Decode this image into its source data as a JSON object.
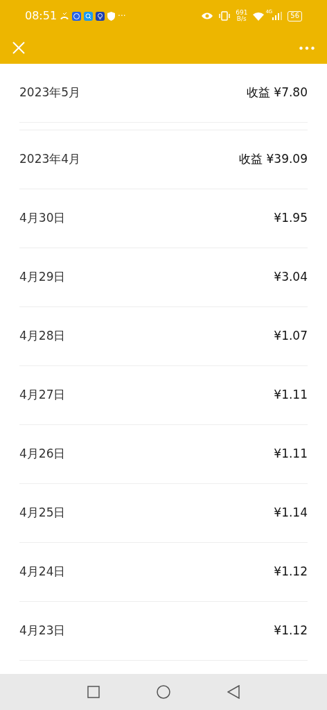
{
  "status_bar": {
    "time": "08:51",
    "more": "···",
    "speed_value": "691",
    "speed_unit": "B/s",
    "network": "4G",
    "battery": "56"
  },
  "sections": [
    {
      "month": "2023年5月",
      "income": "收益 ¥7.80"
    },
    {
      "month": "2023年4月",
      "income": "收益 ¥39.09",
      "days": [
        {
          "date": "4月30日",
          "amount": "¥1.95"
        },
        {
          "date": "4月29日",
          "amount": "¥3.04"
        },
        {
          "date": "4月28日",
          "amount": "¥1.07"
        },
        {
          "date": "4月27日",
          "amount": "¥1.11"
        },
        {
          "date": "4月26日",
          "amount": "¥1.11"
        },
        {
          "date": "4月25日",
          "amount": "¥1.14"
        },
        {
          "date": "4月24日",
          "amount": "¥1.12"
        },
        {
          "date": "4月23日",
          "amount": "¥1.12"
        }
      ]
    }
  ]
}
